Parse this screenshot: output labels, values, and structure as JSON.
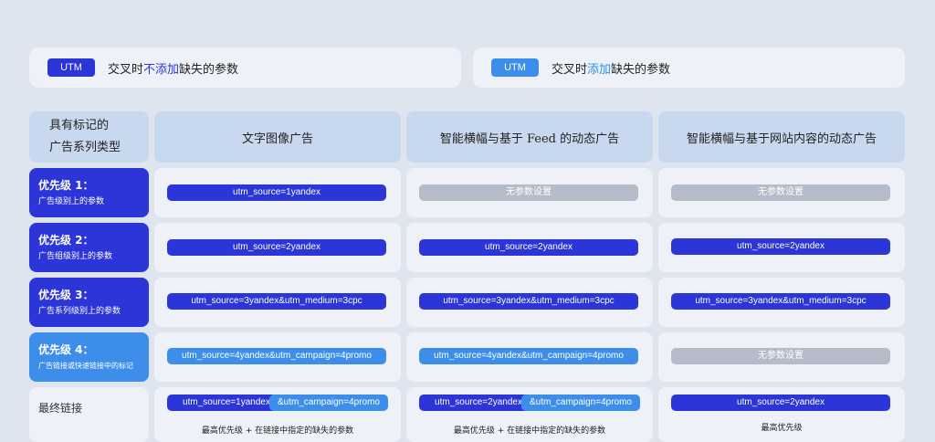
{
  "legend": {
    "left": {
      "badge": "UTM",
      "pre": "交叉时",
      "em": "不添加",
      "post": "缺失的参数",
      "color": "#2b35d8"
    },
    "right": {
      "badge": "UTM",
      "pre": "交叉时",
      "em": "添加",
      "post": "缺失的参数",
      "color": "#3d8eea"
    }
  },
  "table": {
    "corner": [
      "具有标记的",
      "广告系列类型"
    ],
    "columns": [
      "文字图像广告",
      "智能横幅与基于 Feed 的动态广告",
      "智能横幅与基于网站内容的动态广告"
    ],
    "rows": [
      {
        "title": "优先级 1：",
        "sub": "广告级别上的参数",
        "cells": [
          "utm_source=1yandex",
          "无参数设置",
          "无参数设置"
        ]
      },
      {
        "title": "优先级 2：",
        "sub": "广告组级别上的参数",
        "cells": [
          "utm_source=2yandex",
          "utm_source=2yandex",
          "utm_source=2yandex"
        ]
      },
      {
        "title": "优先级 3：",
        "sub": "广告系列级别上的参数",
        "cells": [
          "utm_source=3yandex&utm_medium=3cpc",
          "utm_source=3yandex&utm_medium=3cpc",
          "utm_source=3yandex&utm_medium=3cpc"
        ]
      },
      {
        "title": "优先级 4：",
        "sub": "广告链接或快速链接中的标记",
        "cells": [
          "utm_source=4yandex&utm_campaign=4promo",
          "utm_source=4yandex&utm_campaign=4promo",
          "无参数设置"
        ]
      }
    ],
    "final": {
      "title": "最终链接",
      "col1": {
        "a": "utm_source=1yandex",
        "b": "&utm_campaign=4promo",
        "note": "最高优先级 + 在链接中指定的缺失的参数"
      },
      "col2": {
        "a": "utm_source=2yandex",
        "b": "&utm_campaign=4promo",
        "note": "最高优先级 + 在链接中指定的缺失的参数"
      },
      "col3": {
        "a": "utm_source=2yandex",
        "note": "最高优先级"
      }
    }
  }
}
